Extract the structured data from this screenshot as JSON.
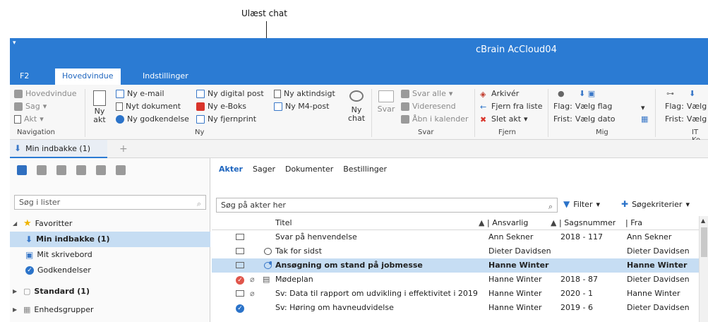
{
  "callout": "Ulæst chat",
  "app": {
    "title": "cBrain AcCloud04",
    "qat_icon": "dropdown-arrow-icon"
  },
  "ribbon_tabs": [
    "F2",
    "Hovedvindue",
    "Indstillinger"
  ],
  "ribbon": {
    "navigation": {
      "items": [
        "Hovedvindue",
        "Sag",
        "Akt"
      ],
      "group": "Navigation"
    },
    "ny": {
      "big_label": "Ny akt",
      "items": [
        "Ny e-mail",
        "Nyt dokument",
        "Ny godkendelse",
        "Ny digital post",
        "Ny e-Boks",
        "Ny fjernprint",
        "Ny aktindsigt",
        "Ny M4-post"
      ],
      "chat_label": "Ny chat",
      "group": "Ny"
    },
    "svar": {
      "big_label": "Svar",
      "items": [
        "Svar alle",
        "Videresend",
        "Åbn i kalender"
      ],
      "group": "Svar"
    },
    "fjern": {
      "items": [
        "Arkivér",
        "Fjern fra liste",
        "Slet akt"
      ],
      "group": "Fjern"
    },
    "mig": {
      "flag_label": "Flag:",
      "flag_value": "Vælg flag",
      "frist_label": "Frist:",
      "frist_value": "Vælg dato",
      "group": "Mig"
    },
    "it": {
      "flag_label": "Flag:",
      "flag_value": "Vælg",
      "frist_label": "Frist:",
      "frist_value": "Vælg",
      "group": "IT Ko"
    }
  },
  "doc_tab": {
    "label": "Min indbakke (1)"
  },
  "left": {
    "search_placeholder": "Søg i lister",
    "tree": [
      {
        "label": "Favoritter"
      },
      {
        "label": "Min indbakke (1)"
      },
      {
        "label": "Mit skrivebord"
      },
      {
        "label": "Godkendelser"
      },
      {
        "label": "Standard (1)"
      },
      {
        "label": "Enhedsgrupper"
      }
    ]
  },
  "right": {
    "subtabs": [
      "Akter",
      "Sager",
      "Dokumenter",
      "Bestillinger"
    ],
    "search_placeholder": "Søg på akter her",
    "filter_label": "Filter",
    "criteria_label": "Søgekriterier",
    "columns": [
      "Titel",
      "Ansvarlig",
      "Sagsnummer",
      "Fra"
    ],
    "rows": [
      {
        "title": "Svar på henvendelse",
        "ansvarlig": "Ann Sekner",
        "sagsnummer": "2018 - 117",
        "fra": "Ann Sekner",
        "icon": "envelope"
      },
      {
        "title": "Tak for sidst",
        "ansvarlig": "Dieter Davidsen",
        "sagsnummer": "",
        "fra": "Dieter Davidsen",
        "icon": "envelope-chat"
      },
      {
        "title": "Ansøgning om stand på jobmesse",
        "ansvarlig": "Hanne Winter",
        "sagsnummer": "",
        "fra": "Hanne Winter",
        "icon": "envelope-chat-unread"
      },
      {
        "title": "Mødeplan",
        "ansvarlig": "Hanne Winter",
        "sagsnummer": "2018 - 87",
        "fra": "Dieter Davidsen",
        "icon": "red-check"
      },
      {
        "title": "Sv: Data til rapport om udvikling i effektivitet i 2019",
        "ansvarlig": "Hanne Winter",
        "sagsnummer": "2020 - 1",
        "fra": "Hanne Winter",
        "icon": "envelope-attach"
      },
      {
        "title": "Sv: Høring om havneudvidelse",
        "ansvarlig": "Hanne Winter",
        "sagsnummer": "2019 - 6",
        "fra": "Dieter Davidsen",
        "icon": "blue-check"
      }
    ]
  }
}
